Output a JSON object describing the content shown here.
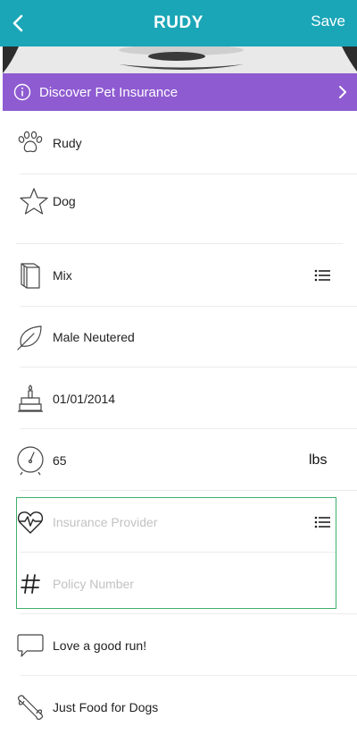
{
  "header": {
    "title": "RUDY",
    "save_label": "Save"
  },
  "banner": {
    "text": "Discover Pet Insurance"
  },
  "fields": {
    "name": {
      "value": "Rudy",
      "icon": "paw-icon"
    },
    "species": {
      "value": "Dog",
      "icon": "star-icon"
    },
    "breed": {
      "value": "Mix",
      "icon": "book-icon"
    },
    "sex": {
      "value": "Male Neutered",
      "icon": "leaf-icon"
    },
    "birthday": {
      "value": "01/01/2014",
      "icon": "birthday-cake-icon"
    },
    "weight": {
      "value": "65",
      "unit": "lbs",
      "icon": "scale-icon"
    },
    "insurance_provider": {
      "placeholder": "Insurance Provider",
      "icon": "heartbeat-icon"
    },
    "policy_number": {
      "placeholder": "Policy Number",
      "icon": "hash-icon"
    },
    "notes": {
      "value": "Love a good run!",
      "icon": "speech-bubble-icon"
    },
    "food": {
      "value": "Just Food for Dogs",
      "icon": "bone-icon"
    }
  },
  "colors": {
    "header": "#1aa6b7",
    "banner": "#8e5bd1",
    "highlight_border": "#3fb06a"
  }
}
